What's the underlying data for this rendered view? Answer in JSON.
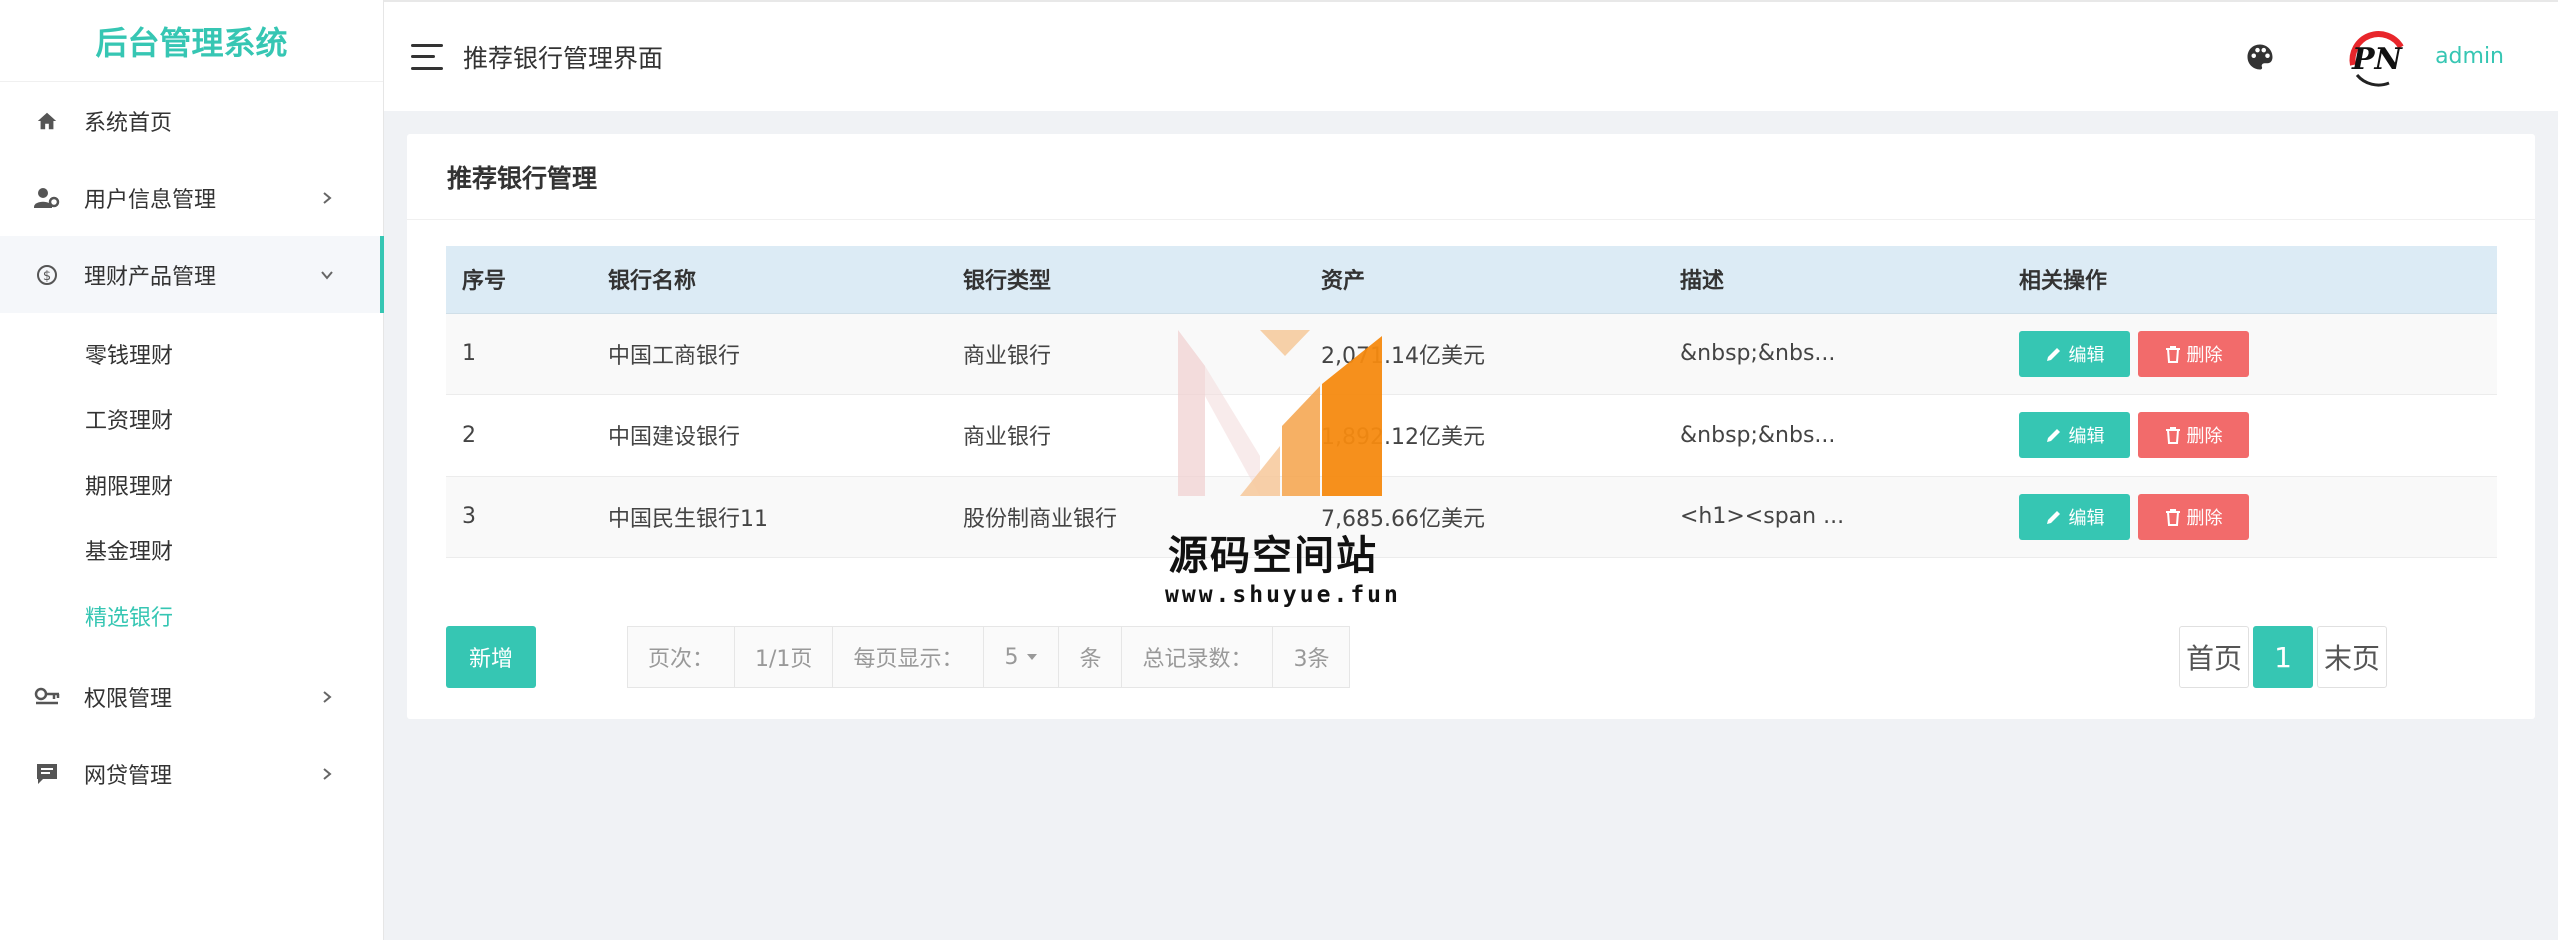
{
  "app": {
    "title": "后台管理系统"
  },
  "colors": {
    "accent": "#36c6b3",
    "danger": "#f26b6b",
    "table_header": "#dcebf5"
  },
  "sidebar": {
    "items": [
      {
        "label": "系统首页",
        "icon": "home-icon"
      },
      {
        "label": "用户信息管理",
        "icon": "user-settings-icon"
      },
      {
        "label": "理财产品管理",
        "icon": "finance-icon",
        "expanded": true,
        "children": [
          {
            "label": "零钱理财"
          },
          {
            "label": "工资理财"
          },
          {
            "label": "期限理财"
          },
          {
            "label": "基金理财"
          },
          {
            "label": "精选银行",
            "active": true
          }
        ]
      },
      {
        "label": "权限管理",
        "icon": "key-icon"
      },
      {
        "label": "网贷管理",
        "icon": "message-icon"
      }
    ]
  },
  "header": {
    "title": "推荐银行管理界面",
    "username": "admin"
  },
  "card": {
    "title": "推荐银行管理"
  },
  "table": {
    "headers": [
      "序号",
      "银行名称",
      "银行类型",
      "资产",
      "描述",
      "相关操作"
    ],
    "rows": [
      {
        "id": "1",
        "name": "中国工商银行",
        "type": "商业银行",
        "assets": "2,071.14亿美元",
        "desc": "&nbsp;&nbs..."
      },
      {
        "id": "2",
        "name": "中国建设银行",
        "type": "商业银行",
        "assets": "1,892.12亿美元",
        "desc": "&nbsp;&nbs..."
      },
      {
        "id": "3",
        "name": "中国民生银行11",
        "type": "股份制商业银行",
        "assets": "7,685.66亿美元",
        "desc": "<h1><span ..."
      }
    ],
    "edit_label": "编辑",
    "delete_label": "删除"
  },
  "footer": {
    "add_label": "新增",
    "page_label": "页次：",
    "page_value": "1/1页",
    "per_page_label": "每页显示：",
    "per_page_value": "5",
    "per_page_unit": "条",
    "total_label": "总记录数：",
    "total_value": "3条",
    "first_label": "首页",
    "current_page": "1",
    "last_label": "末页"
  },
  "watermark": {
    "name": "源码空间站",
    "url": "www.shuyue.fun"
  }
}
